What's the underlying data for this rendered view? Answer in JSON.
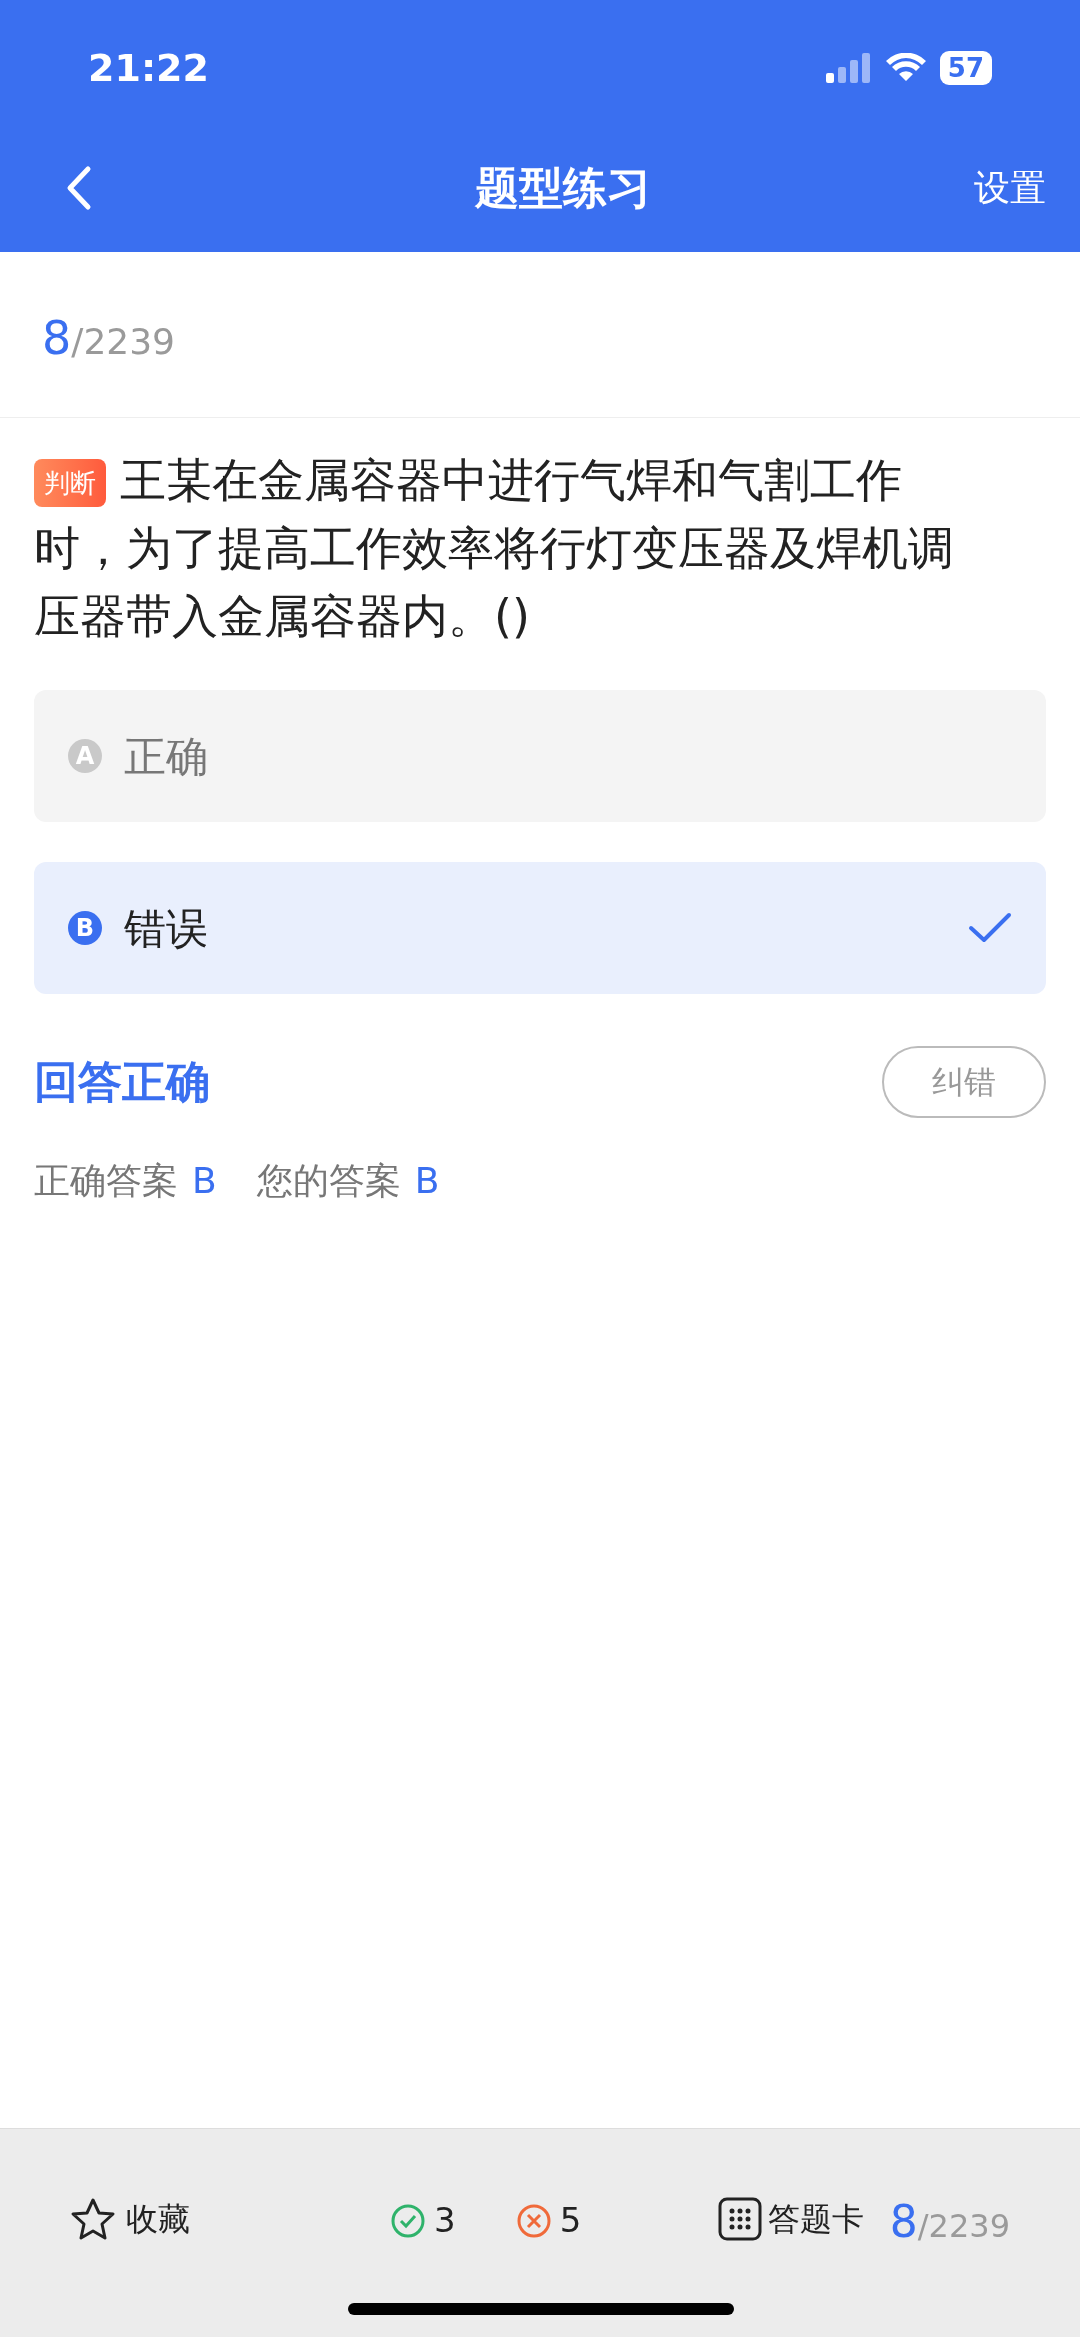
{
  "status_bar": {
    "time": "21:22",
    "battery": "57"
  },
  "header": {
    "title": "题型练习",
    "action": "设置"
  },
  "progress": {
    "current": "8",
    "total": "/2239"
  },
  "question": {
    "tag": "判断",
    "text": "王某在金属容器中进行气焊和气割工作时，为了提高工作效率将行灯变压器及焊机调压器带入金属容器内。()"
  },
  "options": [
    {
      "letter": "A",
      "text": "正确",
      "selected": false
    },
    {
      "letter": "B",
      "text": "错误",
      "selected": true
    }
  ],
  "result": {
    "title": "回答正确",
    "report_button": "纠错",
    "correct_label": "正确答案",
    "correct_value": "B",
    "your_label": "您的答案",
    "your_value": "B"
  },
  "bottom_bar": {
    "favorite": "收藏",
    "right_count": "3",
    "wrong_count": "5",
    "answer_card": "答题卡",
    "current": "8",
    "total": "/2239"
  }
}
